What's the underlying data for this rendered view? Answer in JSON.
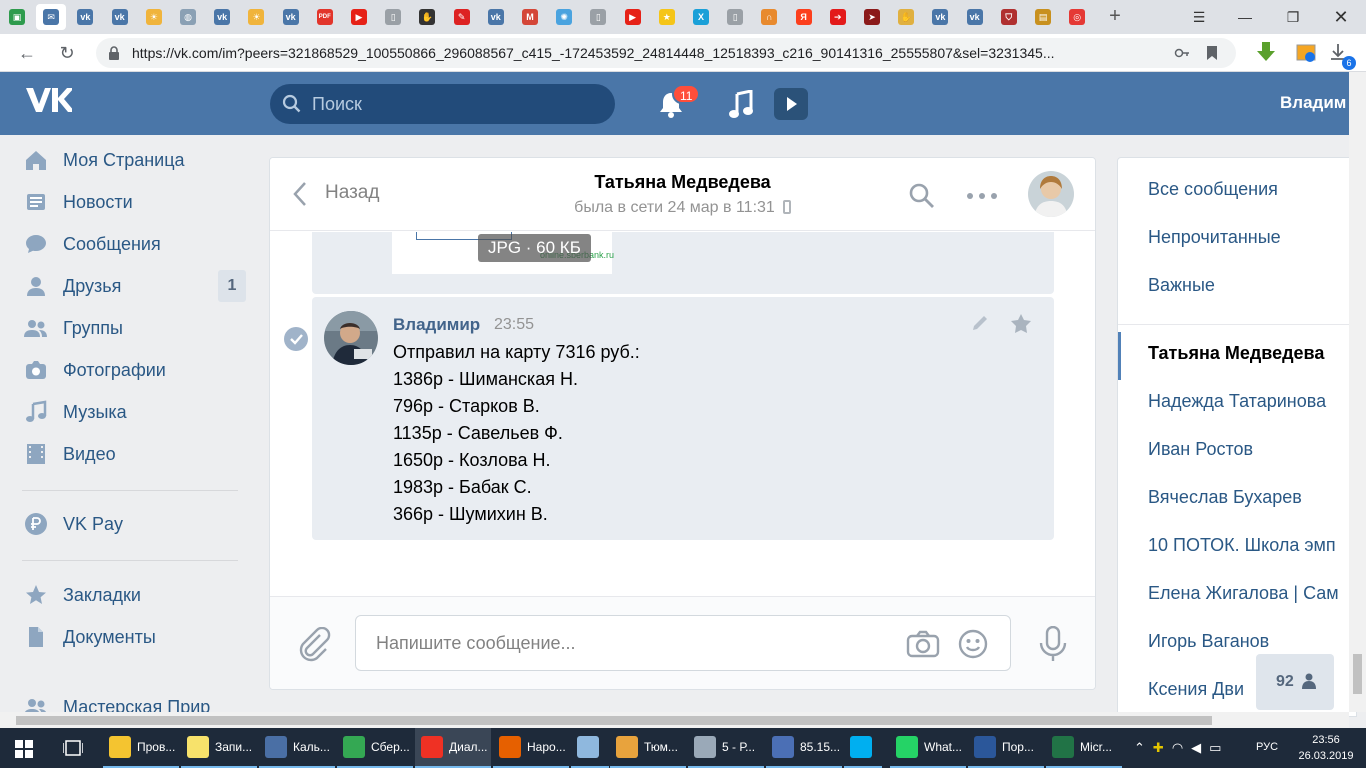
{
  "browser": {
    "url": "https://vk.com/im?peers=321868529_100550866_296088567_c415_-172453592_24814448_12518393_c216_90141316_25555807&sel=3231345...",
    "downloads_badge": "6",
    "tabs": [
      {
        "icon": "green-app-icon",
        "color": "#2e9b4d",
        "glyph": "▣"
      },
      {
        "icon": "message-icon",
        "color": "#4a76a8",
        "glyph": "✉",
        "active": true
      },
      {
        "icon": "vk-icon",
        "color": "#4a76a8",
        "glyph": "vk"
      },
      {
        "icon": "vk-icon",
        "color": "#4a76a8",
        "glyph": "vk"
      },
      {
        "icon": "sun-icon",
        "color": "#f0b43c",
        "glyph": "☀"
      },
      {
        "icon": "globe-icon",
        "color": "#8aa0b4",
        "glyph": "◍"
      },
      {
        "icon": "vk-icon",
        "color": "#4a76a8",
        "glyph": "vk"
      },
      {
        "icon": "sun-icon",
        "color": "#f0b43c",
        "glyph": "☀"
      },
      {
        "icon": "vk-icon",
        "color": "#4a76a8",
        "glyph": "vk"
      },
      {
        "icon": "pdf-icon",
        "color": "#e2352b",
        "glyph": "PDF"
      },
      {
        "icon": "youtube-icon",
        "color": "#e62117",
        "glyph": "▶"
      },
      {
        "icon": "document-icon",
        "color": "#9aa0a6",
        "glyph": "▯"
      },
      {
        "icon": "hand-icon",
        "color": "#333333",
        "glyph": "✋"
      },
      {
        "icon": "feather-icon",
        "color": "#d22",
        "glyph": "✎"
      },
      {
        "icon": "vk-icon",
        "color": "#4a76a8",
        "glyph": "vk"
      },
      {
        "icon": "gmail-icon",
        "color": "#d44638",
        "glyph": "M"
      },
      {
        "icon": "gear-colored-icon",
        "color": "#4aa3df",
        "glyph": "✺"
      },
      {
        "icon": "document-icon",
        "color": "#9aa0a6",
        "glyph": "▯"
      },
      {
        "icon": "youtube-icon",
        "color": "#e62117",
        "glyph": "▶"
      },
      {
        "icon": "star-icon",
        "color": "#f5c518",
        "glyph": "★"
      },
      {
        "icon": "dna-icon",
        "color": "#1aa0d8",
        "glyph": "X"
      },
      {
        "icon": "document-icon",
        "color": "#9aa0a6",
        "glyph": "▯"
      },
      {
        "icon": "rainbow-icon",
        "color": "#e88a2e",
        "glyph": "∩"
      },
      {
        "icon": "yandex-icon",
        "color": "#fc3f1d",
        "glyph": "Я"
      },
      {
        "icon": "arrow-right-icon",
        "color": "#e31a1a",
        "glyph": "➔"
      },
      {
        "icon": "bird-icon",
        "color": "#8b1a1a",
        "glyph": "➤"
      },
      {
        "icon": "hand-gold-icon",
        "color": "#e0b040",
        "glyph": "✋"
      },
      {
        "icon": "vk-icon",
        "color": "#4a76a8",
        "glyph": "vk"
      },
      {
        "icon": "vk-icon",
        "color": "#4a76a8",
        "glyph": "vk"
      },
      {
        "icon": "emblem-icon",
        "color": "#b03030",
        "glyph": "⛉"
      },
      {
        "icon": "book-icon",
        "color": "#c8901e",
        "glyph": "▤"
      },
      {
        "icon": "target-icon",
        "color": "#e53935",
        "glyph": "◎"
      }
    ]
  },
  "vk": {
    "search_placeholder": "Поиск",
    "notifications_count": "11",
    "username": "Владим"
  },
  "leftnav": [
    {
      "name": "my-page",
      "label": "Моя Страница",
      "icon": "home-icon"
    },
    {
      "name": "news",
      "label": "Новости",
      "icon": "news-icon"
    },
    {
      "name": "messages",
      "label": "Сообщения",
      "icon": "chat-icon"
    },
    {
      "name": "friends",
      "label": "Друзья",
      "icon": "person-icon",
      "count": "1"
    },
    {
      "name": "groups",
      "label": "Группы",
      "icon": "group-icon"
    },
    {
      "name": "photos",
      "label": "Фотографии",
      "icon": "camera-icon"
    },
    {
      "name": "music",
      "label": "Музыка",
      "icon": "music-icon"
    },
    {
      "name": "video",
      "label": "Видео",
      "icon": "film-icon"
    },
    {
      "name": "vkpay",
      "label": "VK Pay",
      "icon": "ruble-icon"
    },
    {
      "name": "bookmarks",
      "label": "Закладки",
      "icon": "star-icon"
    },
    {
      "name": "documents",
      "label": "Документы",
      "icon": "document-icon"
    },
    {
      "name": "workshop",
      "label": "Мастерская Прир",
      "icon": "group-icon"
    }
  ],
  "dialog": {
    "back_label": "Назад",
    "peer_name": "Татьяна Медведева",
    "peer_status": "была в сети 24 мар в 11:31",
    "attachment_badge": "JPG · 60 КБ",
    "attachment_site": "online.sberbank.ru",
    "message": {
      "author": "Владимир",
      "time": "23:55",
      "lines": [
        "Отправил на карту 7316 руб.:",
        "1386р - Шиманская Н.",
        "796р - Старков В.",
        "1135р - Савельев Ф.",
        "1650р - Козлова Н.",
        "1983р - Бабак С.",
        "366р - Шумихин В."
      ]
    },
    "input_placeholder": "Напишите сообщение..."
  },
  "rightpanel": {
    "filters": [
      "Все сообщения",
      "Непрочитанные",
      "Важные"
    ],
    "active_chat": "Татьяна Медведева",
    "chats": [
      "Надежда Татаринова",
      "Иван Ростов",
      "Вячеслав Бухарев",
      "10 ПОТОК. Школа эмп",
      "Елена Жигалова | Сам",
      "Игорь Ваганов",
      "Ксения Дви"
    ],
    "online_count": "92"
  },
  "taskbar": {
    "items": [
      {
        "label": "Пров...",
        "icon": "explorer-icon",
        "color": "#f4c430"
      },
      {
        "label": "Запи...",
        "icon": "notes-icon",
        "color": "#f7e26b"
      },
      {
        "label": "Каль...",
        "icon": "calculator-icon",
        "color": "#4a6fa5"
      },
      {
        "label": "Сбер...",
        "icon": "chrome-icon",
        "color": "#34a853"
      },
      {
        "label": "Диал...",
        "icon": "yandex-browser-icon",
        "color": "#ef3124",
        "active": true
      },
      {
        "label": "Наро...",
        "icon": "firefox-icon",
        "color": "#e66000"
      },
      {
        "label": "",
        "icon": "pen-app-icon",
        "color": "#8fb8de"
      },
      {
        "label": "Тюм...",
        "icon": "paint-icon",
        "color": "#e8a33d"
      },
      {
        "label": "5 - Р...",
        "icon": "palette-icon",
        "color": "#9aa9b8"
      },
      {
        "label": "85.15...",
        "icon": "remote-icon",
        "color": "#4b6fb5"
      },
      {
        "label": "",
        "icon": "skype-icon",
        "color": "#00aff0"
      },
      {
        "label": "What...",
        "icon": "whatsapp-icon",
        "color": "#25d366"
      },
      {
        "label": "Пор...",
        "icon": "word-icon",
        "color": "#2b579a"
      },
      {
        "label": "Micr...",
        "icon": "excel-icon",
        "color": "#217346"
      }
    ],
    "lang": "РУС",
    "time": "23:56",
    "date": "26.03.2019"
  }
}
